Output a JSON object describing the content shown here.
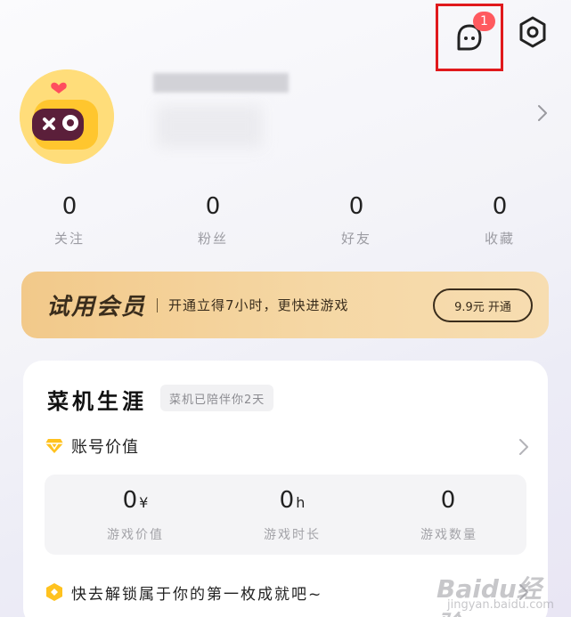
{
  "header": {
    "message_badge_count": "1",
    "icons": [
      "message-icon",
      "settings-icon"
    ]
  },
  "stats": [
    {
      "value": "0",
      "label": "关注"
    },
    {
      "value": "0",
      "label": "粉丝"
    },
    {
      "value": "0",
      "label": "好友"
    },
    {
      "value": "0",
      "label": "收藏"
    }
  ],
  "vip": {
    "title": "试用会员",
    "description": "开通立得7小时，更快进游戏",
    "button_label": "9.9元 开通"
  },
  "career": {
    "title": "菜机生涯",
    "tag": "菜机已陪伴你2天",
    "account_value_label": "账号价值",
    "metrics": [
      {
        "value": "0",
        "unit": "¥",
        "label": "游戏价值"
      },
      {
        "value": "0",
        "unit": "h",
        "label": "游戏时长"
      },
      {
        "value": "0",
        "unit": "",
        "label": "游戏数量"
      }
    ],
    "achievement_text": "快去解锁属于你的第一枚成就吧~"
  },
  "watermark": {
    "text": "Baidu经验",
    "sub": "jingyan.baidu.com"
  },
  "colors": {
    "highlight_box": "#e0191c",
    "badge": "#ff5a5f",
    "vip_gold": "#f2c98a",
    "avatar_yellow": "#ffdd7a"
  }
}
